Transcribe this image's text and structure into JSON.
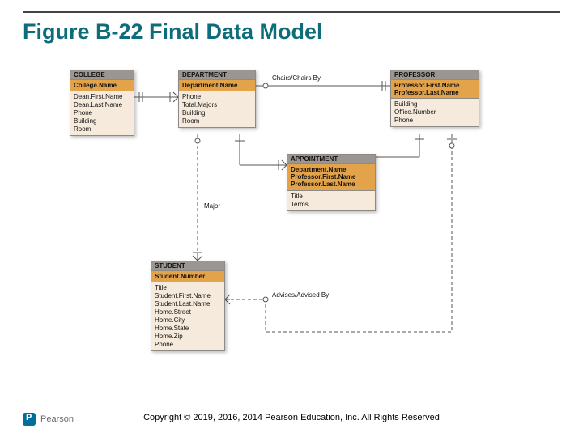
{
  "title": "Figure B-22 Final Data Model",
  "copyright": "Copyright © 2019, 2016, 2014 Pearson Education, Inc. All Rights Reserved",
  "brand": "Pearson",
  "entities": {
    "college": {
      "title": "COLLEGE",
      "pk": [
        "College.Name"
      ],
      "attrs": [
        "Dean.First.Name",
        "Dean.Last.Name",
        "Phone",
        "Building",
        "Room"
      ]
    },
    "department": {
      "title": "DEPARTMENT",
      "pk": [
        "Department.Name"
      ],
      "attrs": [
        "Phone",
        "Total.Majors",
        "Building",
        "Room"
      ]
    },
    "professor": {
      "title": "PROFESSOR",
      "pk": [
        "Professor.First.Name",
        "Professor.Last.Name"
      ],
      "attrs": [
        "Building",
        "Office.Number",
        "Phone"
      ]
    },
    "appointment": {
      "title": "APPOINTMENT",
      "pk": [
        "Department.Name",
        "Professor.First.Name",
        "Professor.Last.Name"
      ],
      "attrs": [
        "Title",
        "Terms"
      ]
    },
    "student": {
      "title": "STUDENT",
      "pk": [
        "Student.Number"
      ],
      "attrs": [
        "Title",
        "Student.First.Name",
        "Student.Last.Name",
        "Home.Street",
        "Home.City",
        "Home.State",
        "Home.Zip",
        "Phone"
      ]
    }
  },
  "relationships": {
    "chairs": "Chairs/Chairs By",
    "major": "Major",
    "advises": "Advises/Advised By"
  }
}
